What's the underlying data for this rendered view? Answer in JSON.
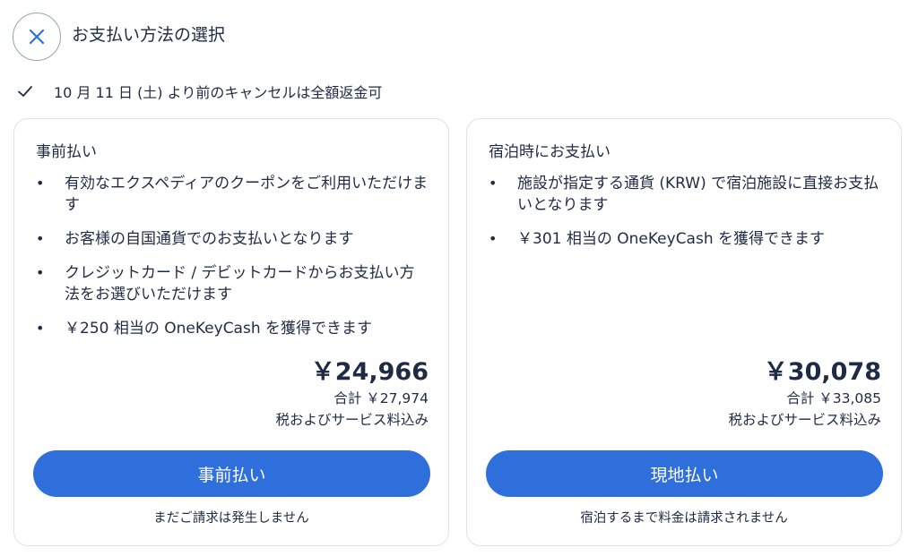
{
  "header": {
    "title": "お支払い方法の選択",
    "close_icon": "close-icon"
  },
  "cancellation": {
    "text": "10 月 11 日 (土) より前のキャンセルは全額返金可",
    "icon": "checkmark-icon"
  },
  "options": [
    {
      "heading": "事前払い",
      "bullets": [
        "有効なエクスペディアのクーポンをご利用いただけます",
        "お客様の自国通貨でのお支払いとなります",
        "クレジットカード / デビットカードからお支払い方法をお選びいただけます",
        "￥250 相当の OneKeyCash を獲得できます"
      ],
      "price": "￥24,966",
      "total": "合計 ￥27,974",
      "tax_note": "税およびサービス料込み",
      "button_label": "事前払い",
      "footnote": "まだご請求は発生しません"
    },
    {
      "heading": "宿泊時にお支払い",
      "bullets": [
        "施設が指定する通貨 (KRW) で宿泊施設に直接お支払いとなります",
        "￥301 相当の OneKeyCash を獲得できます"
      ],
      "price": "￥30,078",
      "total": "合計 ￥33,085",
      "tax_note": "税およびサービス料込み",
      "button_label": "現地払い",
      "footnote": "宿泊するまで料金は請求されません"
    }
  ],
  "colors": {
    "accent": "#2f6fdc",
    "text": "#1f2a44",
    "border": "#dfe2e8"
  }
}
